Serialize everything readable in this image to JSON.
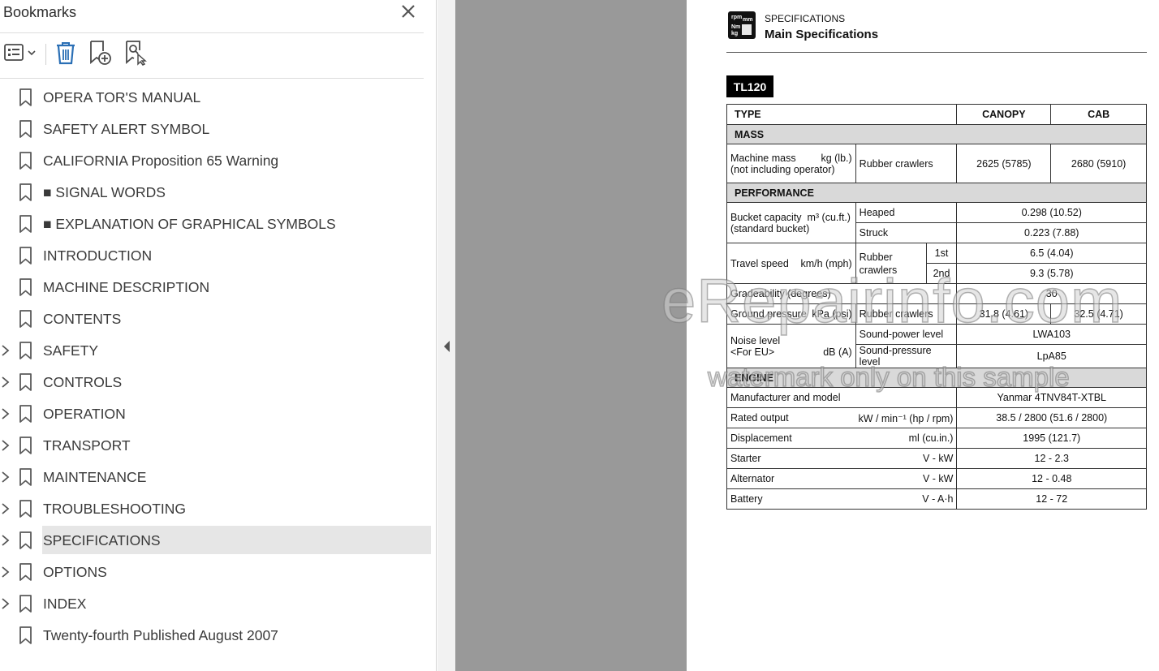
{
  "bookmarks_panel": {
    "title": "Bookmarks",
    "items": [
      {
        "label": "OPERA TOR'S MANUAL",
        "expandable": false
      },
      {
        "label": "SAFETY ALERT SYMBOL",
        "expandable": false
      },
      {
        "label": "CALIFORNIA  Proposition 65 Warning",
        "expandable": false
      },
      {
        "label": "■ SIGNAL WORDS",
        "expandable": false
      },
      {
        "label": "■ EXPLANATION OF GRAPHICAL SYMBOLS",
        "expandable": false
      },
      {
        "label": "INTRODUCTION",
        "expandable": false
      },
      {
        "label": "MACHINE DESCRIPTION",
        "expandable": false
      },
      {
        "label": "CONTENTS",
        "expandable": false
      },
      {
        "label": "SAFETY",
        "expandable": true
      },
      {
        "label": "CONTROLS",
        "expandable": true
      },
      {
        "label": "OPERATION",
        "expandable": true
      },
      {
        "label": "TRANSPORT",
        "expandable": true
      },
      {
        "label": "MAINTENANCE",
        "expandable": true
      },
      {
        "label": "TROUBLESHOOTING",
        "expandable": true
      },
      {
        "label": "SPECIFICATIONS",
        "expandable": true,
        "selected": true
      },
      {
        "label": "OPTIONS",
        "expandable": true
      },
      {
        "label": "INDEX",
        "expandable": true
      },
      {
        "label": "Twenty-fourth Published August 2007",
        "expandable": false
      }
    ],
    "toolbar_icons": [
      "options-menu-icon",
      "delete-bookmark-icon",
      "new-bookmark-icon",
      "find-current-bookmark-icon"
    ]
  },
  "document": {
    "section_small": "SPECIFICATIONS",
    "section_title": "Main Specifications",
    "spec_icon_text": [
      "rpm",
      "mm",
      "Nm",
      "kg"
    ],
    "model": "TL120",
    "table": {
      "type_label": "TYPE",
      "col_canopy": "CANOPY",
      "col_cab": "CAB",
      "mass_section": "MASS",
      "machine_mass_label": "Machine mass",
      "machine_mass_unit": "kg (lb.)",
      "machine_mass_note": "(not including operator)",
      "rubber_crawlers": "Rubber crawlers",
      "mass_canopy": "2625 (5785)",
      "mass_cab": "2680 (5910)",
      "performance_section": "PERFORMANCE",
      "bucket_label": "Bucket capacity",
      "bucket_unit": "m³ (cu.ft.)",
      "bucket_note": "(standard bucket)",
      "heaped": "Heaped",
      "heaped_value": "0.298 (10.52)",
      "struck": "Struck",
      "struck_value": "0.223 (7.88)",
      "travel_label": "Travel speed",
      "travel_unit": "km/h (mph)",
      "travel_sub": "Rubber crawlers",
      "first": "1st",
      "first_value": "6.5 (4.04)",
      "second": "2nd",
      "second_value": "9.3 (5.78)",
      "gradeability_label": "Gradeability (degrees)",
      "gradeability_value": "30",
      "ground_label": "Ground pressure",
      "ground_unit": "kPa (psi)",
      "ground_canopy": "31.8 (4.61)",
      "ground_cab": "32.5 (4.71)",
      "noise_label": "Noise level",
      "noise_note": "<For EU>",
      "noise_unit": "dB (A)",
      "sound_power": "Sound-power level",
      "sound_power_value": "LWA103",
      "sound_pressure": "Sound-pressure level",
      "sound_pressure_value": "LpA85",
      "engine_section": "ENGINE",
      "manufacturer_label": "Manufacturer and model",
      "manufacturer_value": "Yanmar 4TNV84T-XTBL",
      "rated_label": "Rated output",
      "rated_unit": "kW / min⁻¹ (hp / rpm)",
      "rated_value": "38.5 / 2800 (51.6 / 2800)",
      "displacement_label": "Displacement",
      "displacement_unit": "ml (cu.in.)",
      "displacement_value": "1995 (121.7)",
      "starter_label": "Starter",
      "starter_unit": "V - kW",
      "starter_value": "12 - 2.3",
      "alternator_label": "Alternator",
      "alternator_unit": "V - kW",
      "alternator_value": "12 - 0.48",
      "battery_label": "Battery",
      "battery_unit": "V - A·h",
      "battery_value": "12 - 72"
    }
  },
  "watermark": {
    "line1": "eRepairinfo.com",
    "line2": "watermark only on this sample"
  }
}
